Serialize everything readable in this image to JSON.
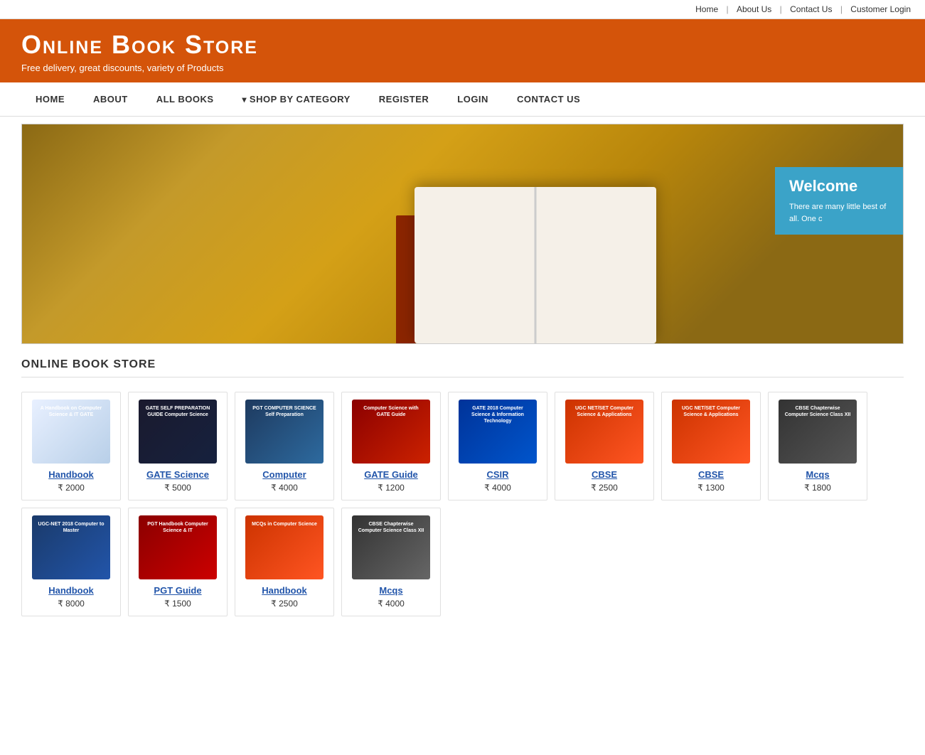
{
  "topbar": {
    "links": [
      {
        "label": "Home",
        "name": "topbar-home"
      },
      {
        "label": "About Us",
        "name": "topbar-about"
      },
      {
        "label": "Contact Us",
        "name": "topbar-contact"
      },
      {
        "label": "Customer Login",
        "name": "topbar-login"
      }
    ]
  },
  "header": {
    "title": "Online Book Store",
    "tagline": "Free delivery, great discounts, variety of Products"
  },
  "nav": {
    "items": [
      {
        "label": "HOME",
        "name": "nav-home"
      },
      {
        "label": "ABOUT",
        "name": "nav-about"
      },
      {
        "label": "ALL BOOKS",
        "name": "nav-allbooks"
      },
      {
        "label": "SHOP BY CATEGORY",
        "name": "nav-category",
        "dropdown": true
      },
      {
        "label": "REGISTER",
        "name": "nav-register"
      },
      {
        "label": "LOGIN",
        "name": "nav-login"
      },
      {
        "label": "CONTACT US",
        "name": "nav-contact"
      }
    ]
  },
  "banner": {
    "welcome_title": "Welcome",
    "welcome_text": "There are many little best of all. One c"
  },
  "section": {
    "title": "ONLINE BOOK STORE"
  },
  "books": [
    {
      "id": 1,
      "title": "Handbook",
      "price": "₹ 2000",
      "cover_label": "A Handbook on Computer Science & IT GATE",
      "cover_class": "cover-1"
    },
    {
      "id": 2,
      "title": "GATE Science",
      "price": "₹ 5000",
      "cover_label": "GATE SELF PREPARATION GUIDE Computer Science",
      "cover_class": "cover-2"
    },
    {
      "id": 3,
      "title": "Computer",
      "price": "₹ 4000",
      "cover_label": "PGT COMPUTER SCIENCE Self Preparation",
      "cover_class": "cover-3"
    },
    {
      "id": 4,
      "title": "GATE Guide",
      "price": "₹ 1200",
      "cover_label": "Computer Science with GATE Guide",
      "cover_class": "cover-4"
    },
    {
      "id": 5,
      "title": "CSIR",
      "price": "₹ 4000",
      "cover_label": "GATE 2018 Computer Science & Information Technology",
      "cover_class": "cover-5"
    },
    {
      "id": 6,
      "title": "CBSE",
      "price": "₹ 2500",
      "cover_label": "UGC NET/SET Computer Science & Applications",
      "cover_class": "cover-6"
    },
    {
      "id": 7,
      "title": "CBSE",
      "price": "₹ 1300",
      "cover_label": "UGC NET/SET Computer Science & Applications",
      "cover_class": "cover-7"
    },
    {
      "id": 8,
      "title": "Mcqs",
      "price": "₹ 1800",
      "cover_label": "CBSE Chapterwise Computer Science Class XII",
      "cover_class": "cover-8"
    },
    {
      "id": 9,
      "title": "Handbook",
      "price": "₹ 8000",
      "cover_label": "UGC-NET 2018 Computer to Master",
      "cover_class": "cover-9"
    },
    {
      "id": 10,
      "title": "PGT Guide",
      "price": "₹ 1500",
      "cover_label": "PGT Handbook Computer Science & IT",
      "cover_class": "cover-10"
    },
    {
      "id": 11,
      "title": "Handbook",
      "price": "₹ 2500",
      "cover_label": "MCQs in Computer Science",
      "cover_class": "cover-11"
    },
    {
      "id": 12,
      "title": "Mcqs",
      "price": "₹ 4000",
      "cover_label": "CBSE Chapterwise Computer Science Class XII",
      "cover_class": "cover-12"
    }
  ]
}
